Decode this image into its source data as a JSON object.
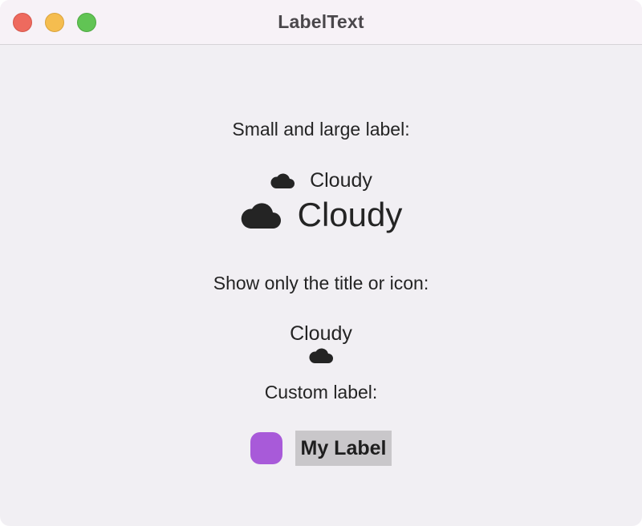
{
  "window": {
    "title": "LabelText"
  },
  "sections": {
    "small_large": {
      "heading": "Small and large label:",
      "small_label": {
        "title": "Cloudy",
        "icon": "cloud-icon"
      },
      "large_label": {
        "title": "Cloudy",
        "icon": "cloud-icon"
      }
    },
    "title_or_icon": {
      "heading": "Show only the title or icon:",
      "title_only": "Cloudy",
      "icon_only": "cloud-icon"
    },
    "custom": {
      "heading": "Custom label:",
      "title": "My Label",
      "icon_color": "#a85ad9",
      "title_background": "#c9c7ca"
    }
  },
  "colors": {
    "window_background": "#f1eff3",
    "titlebar_background": "#f7f2f7",
    "close": "#ee6a5e",
    "minimize": "#f5bd4f",
    "zoom": "#61c454",
    "text": "#242424"
  }
}
